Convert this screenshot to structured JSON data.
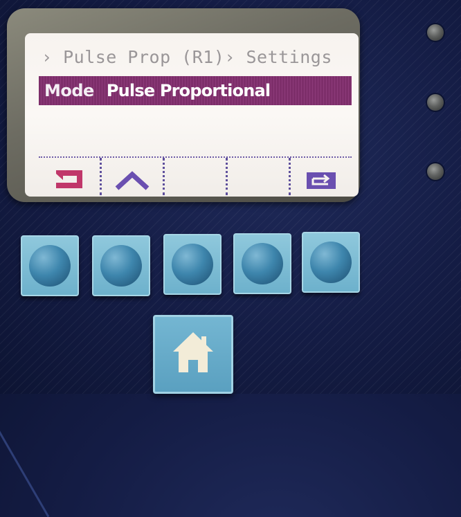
{
  "display": {
    "breadcrumb": "› Pulse Prop (R1)› Settings",
    "mode_label": "Mode",
    "mode_value": "Pulse Proportional",
    "softkeys": [
      {
        "icon": "back-arrow-icon"
      },
      {
        "icon": "chevron-up-icon"
      },
      {
        "icon": ""
      },
      {
        "icon": ""
      },
      {
        "icon": "enter-icon"
      }
    ]
  },
  "colors": {
    "panel": "#141c44",
    "lcd_background": "#f7f3ef",
    "highlight_bar": "#7d2e6a",
    "breadcrumb_text": "#9a9698",
    "back_icon": "#c0376a",
    "nav_icon": "#6a4fb0",
    "button": "#6db1cc"
  },
  "hardware": {
    "soft_buttons": 5,
    "status_leds": 3,
    "home_button_icon": "home-icon"
  }
}
